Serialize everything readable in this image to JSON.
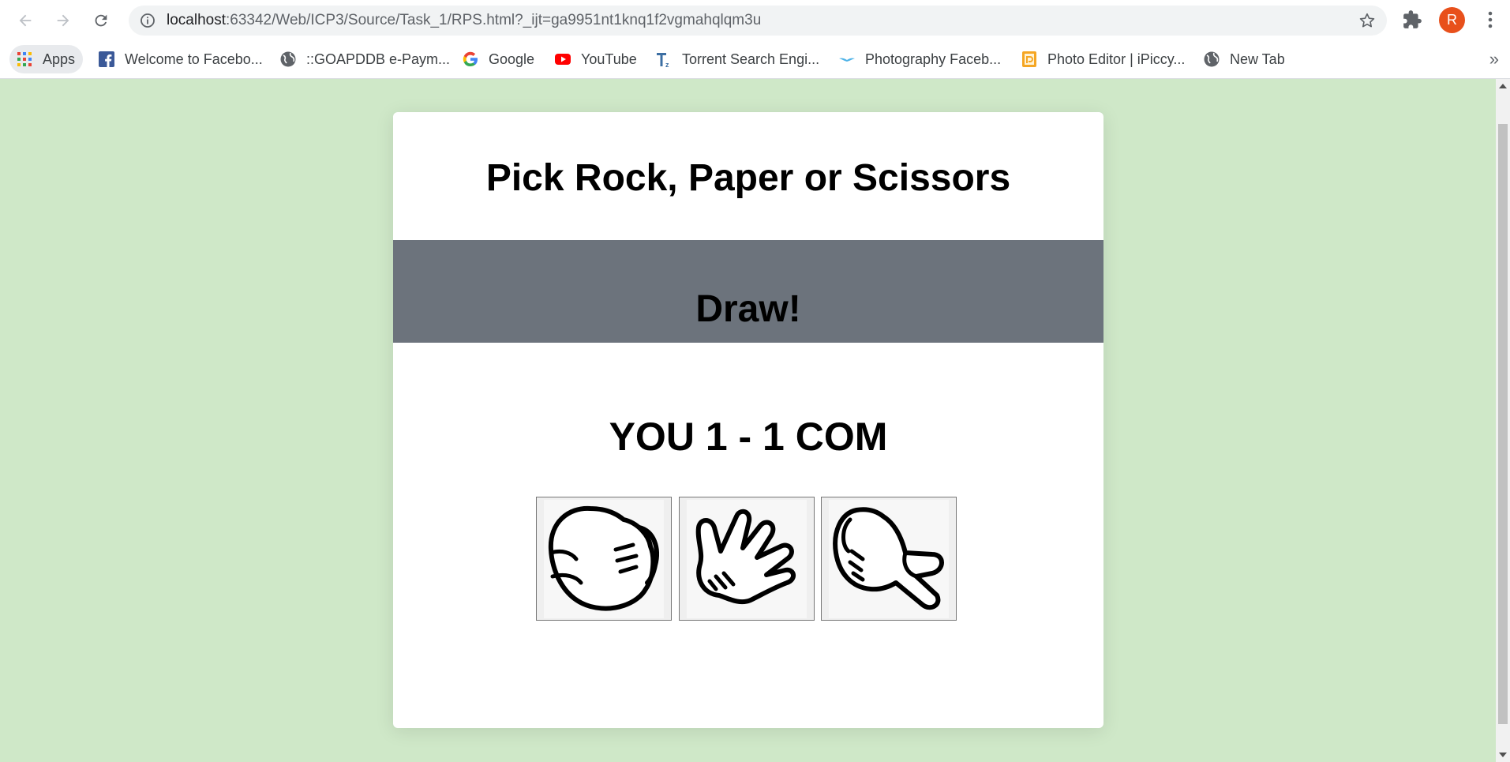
{
  "browser": {
    "url_host": "localhost",
    "url_path": ":63342/Web/ICP3/Source/Task_1/RPS.html?_ijt=ga9951nt1knq1f2vgmahqlqm3u",
    "avatar_letter": "R"
  },
  "bookmarks": [
    {
      "label": "Apps",
      "icon": "apps-grid-icon"
    },
    {
      "label": "Welcome to Facebo...",
      "icon": "facebook-icon"
    },
    {
      "label": "::GOAPDDB e-Paym...",
      "icon": "globe-icon"
    },
    {
      "label": "Google",
      "icon": "google-icon"
    },
    {
      "label": "YouTube",
      "icon": "youtube-icon"
    },
    {
      "label": "Torrent Search Engi...",
      "icon": "tz-icon"
    },
    {
      "label": "Photography Faceb...",
      "icon": "bird-icon"
    },
    {
      "label": "Photo Editor | iPiccy...",
      "icon": "ipiccy-icon"
    },
    {
      "label": "New Tab",
      "icon": "globe-icon"
    }
  ],
  "game": {
    "title": "Pick Rock, Paper or Scissors",
    "result": "Draw!",
    "score": "YOU 1 - 1 COM",
    "choices": [
      "rock",
      "paper",
      "scissors"
    ]
  },
  "colors": {
    "page_bg": "#cfe8c8",
    "result_band": "#6c737c",
    "avatar": "#e8501b"
  }
}
